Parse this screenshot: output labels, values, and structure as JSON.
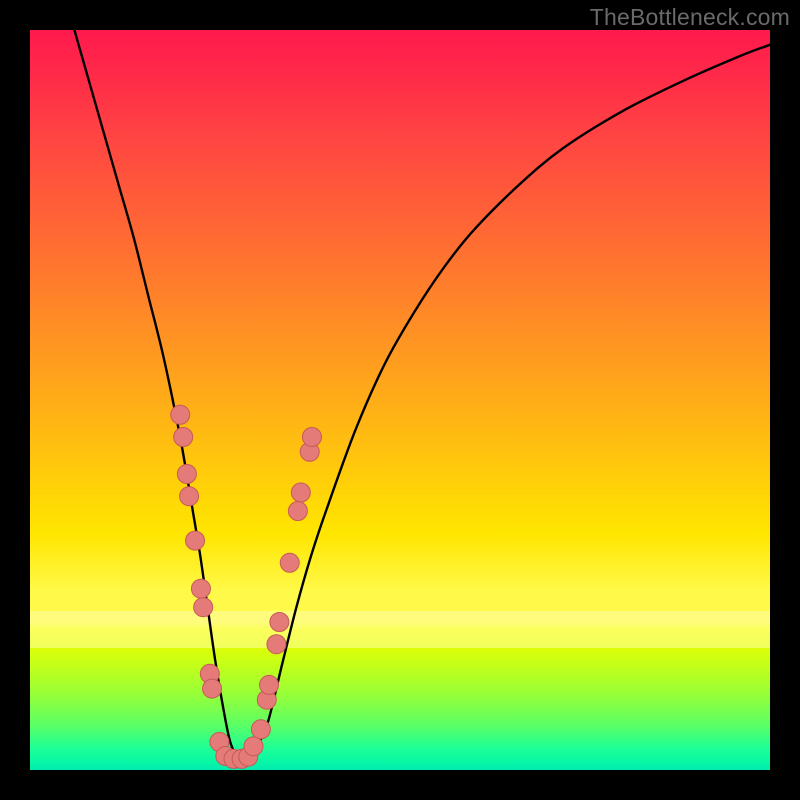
{
  "watermark": "TheBottleneck.com",
  "colors": {
    "border": "#000000",
    "curve": "#000000",
    "dot_fill": "#e47b78",
    "dot_stroke": "#c65a57"
  },
  "chart_data": {
    "type": "line",
    "title": "",
    "xlabel": "",
    "ylabel": "",
    "xlim": [
      0,
      100
    ],
    "ylim": [
      0,
      100
    ],
    "grid": false,
    "series": [
      {
        "name": "bottleneck-curve",
        "x": [
          6,
          8,
          10,
          12,
          14,
          16,
          18,
          20,
          21,
          22,
          23,
          24,
          25,
          26,
          27,
          28,
          29,
          30,
          32,
          34,
          36,
          38,
          40,
          44,
          48,
          52,
          56,
          60,
          66,
          72,
          80,
          88,
          96,
          100
        ],
        "y": [
          100,
          93,
          86,
          79,
          72,
          64,
          56,
          46.5,
          41,
          35,
          29,
          22,
          15,
          9,
          4,
          1.8,
          1.5,
          2.2,
          6,
          14,
          22,
          29,
          35,
          46,
          55,
          62,
          68,
          73,
          79,
          84,
          89,
          93,
          96.5,
          98
        ]
      }
    ],
    "dots": {
      "name": "highlight-markers",
      "points": [
        {
          "x": 20.3,
          "y": 48
        },
        {
          "x": 20.7,
          "y": 45
        },
        {
          "x": 21.2,
          "y": 40
        },
        {
          "x": 21.5,
          "y": 37
        },
        {
          "x": 22.3,
          "y": 31
        },
        {
          "x": 23.1,
          "y": 24.5
        },
        {
          "x": 23.4,
          "y": 22
        },
        {
          "x": 24.3,
          "y": 13
        },
        {
          "x": 24.6,
          "y": 11
        },
        {
          "x": 25.6,
          "y": 3.8
        },
        {
          "x": 26.4,
          "y": 1.9
        },
        {
          "x": 27.5,
          "y": 1.5
        },
        {
          "x": 28.6,
          "y": 1.5
        },
        {
          "x": 29.5,
          "y": 1.8
        },
        {
          "x": 30.2,
          "y": 3.2
        },
        {
          "x": 31.2,
          "y": 5.5
        },
        {
          "x": 32.0,
          "y": 9.5
        },
        {
          "x": 32.3,
          "y": 11.5
        },
        {
          "x": 33.3,
          "y": 17
        },
        {
          "x": 33.7,
          "y": 20
        },
        {
          "x": 35.1,
          "y": 28
        },
        {
          "x": 36.2,
          "y": 35
        },
        {
          "x": 36.6,
          "y": 37.5
        },
        {
          "x": 37.8,
          "y": 43
        },
        {
          "x": 38.1,
          "y": 45
        }
      ],
      "radius_px": 9.5
    }
  }
}
